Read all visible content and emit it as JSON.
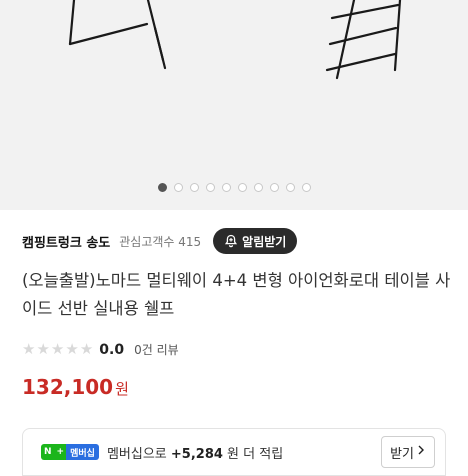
{
  "store": {
    "name": "캠핑트렁크 송도",
    "fans": "관심고객수 415",
    "alarm_label": "알림받기"
  },
  "product": {
    "title": "(오늘출발)노마드 멀티웨이 4+4 변형 아이언화로대 테이블 사이드 선반 실내용 쉘프"
  },
  "rating": {
    "score": "0.0",
    "reviews": "0건 리뷰",
    "stars": 5
  },
  "price": {
    "amount": "132,100",
    "unit": "원"
  },
  "membership": {
    "badge_n": "N",
    "badge_plus": "+",
    "badge_label": "멤버십",
    "text_prefix": "멤버십으로",
    "points": "+5,284",
    "text_suffix": "원 더 적립",
    "button_label": "받기",
    "button_icon": "chevron-right-icon"
  },
  "carousel": {
    "total": 10,
    "active": 1
  },
  "colors": {
    "price": "#c82b25",
    "alarm_bg": "#2b2b2b",
    "naver_green": "#1bb51b",
    "member_blue": "#2a6ee0"
  }
}
